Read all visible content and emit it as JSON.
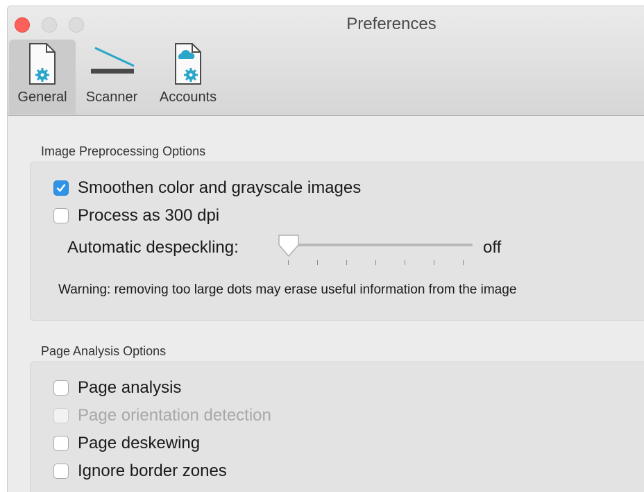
{
  "window": {
    "title": "Preferences"
  },
  "toolbar": {
    "tabs": [
      {
        "label": "General",
        "icon": "general-settings-doc-icon",
        "active": true
      },
      {
        "label": "Scanner",
        "icon": "scanner-icon",
        "active": false
      },
      {
        "label": "Accounts",
        "icon": "accounts-cloud-doc-icon",
        "active": false
      }
    ]
  },
  "image_preprocessing": {
    "title": "Image Preprocessing Options",
    "smoothen": {
      "label": "Smoothen color and grayscale images",
      "checked": true
    },
    "process300": {
      "label": "Process as 300 dpi",
      "checked": false
    },
    "despeckling": {
      "label": "Automatic despeckling:",
      "value": "off"
    },
    "warning": "Warning: removing too large dots may erase useful information from the image"
  },
  "page_analysis": {
    "title": "Page Analysis Options",
    "page_analysis": {
      "label": "Page analysis",
      "checked": false
    },
    "orientation": {
      "label": "Page orientation detection",
      "checked": false,
      "enabled": false
    },
    "deskewing": {
      "label": "Page deskewing",
      "checked": false
    },
    "ignore_border": {
      "label": "Ignore border zones",
      "checked": false
    }
  },
  "colors": {
    "accent": "#2f93e8",
    "icon_teal": "#2aa6c9",
    "close": "#fc605b"
  }
}
